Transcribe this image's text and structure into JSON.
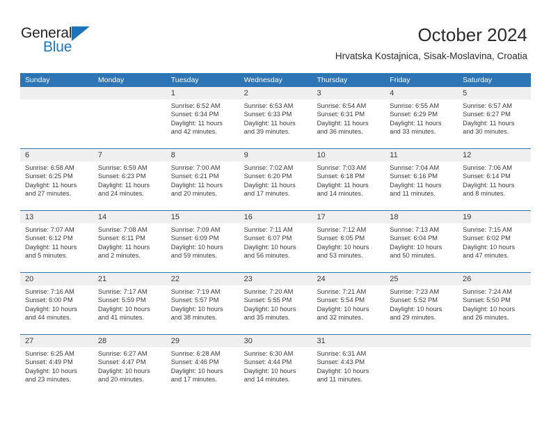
{
  "brand": {
    "name_top": "General",
    "name_bottom": "Blue",
    "accent_color": "#1b75bb"
  },
  "header": {
    "title": "October 2024",
    "subtitle": "Hrvatska Kostajnica, Sisak-Moslavina, Croatia"
  },
  "colors": {
    "header_blue": "#2e75b6",
    "daynum_gray": "#efefef",
    "text": "#3a3a3a"
  },
  "calendar": {
    "weekday_headers": [
      "Sunday",
      "Monday",
      "Tuesday",
      "Wednesday",
      "Thursday",
      "Friday",
      "Saturday"
    ],
    "weeks": [
      [
        {
          "day": "",
          "empty": true,
          "sunrise": "",
          "sunset": "",
          "daylight1": "",
          "daylight2": ""
        },
        {
          "day": "",
          "empty": true,
          "sunrise": "",
          "sunset": "",
          "daylight1": "",
          "daylight2": ""
        },
        {
          "day": "1",
          "sunrise": "Sunrise: 6:52 AM",
          "sunset": "Sunset: 6:34 PM",
          "daylight1": "Daylight: 11 hours",
          "daylight2": "and 42 minutes."
        },
        {
          "day": "2",
          "sunrise": "Sunrise: 6:53 AM",
          "sunset": "Sunset: 6:33 PM",
          "daylight1": "Daylight: 11 hours",
          "daylight2": "and 39 minutes."
        },
        {
          "day": "3",
          "sunrise": "Sunrise: 6:54 AM",
          "sunset": "Sunset: 6:31 PM",
          "daylight1": "Daylight: 11 hours",
          "daylight2": "and 36 minutes."
        },
        {
          "day": "4",
          "sunrise": "Sunrise: 6:55 AM",
          "sunset": "Sunset: 6:29 PM",
          "daylight1": "Daylight: 11 hours",
          "daylight2": "and 33 minutes."
        },
        {
          "day": "5",
          "sunrise": "Sunrise: 6:57 AM",
          "sunset": "Sunset: 6:27 PM",
          "daylight1": "Daylight: 11 hours",
          "daylight2": "and 30 minutes."
        }
      ],
      [
        {
          "day": "6",
          "sunrise": "Sunrise: 6:58 AM",
          "sunset": "Sunset: 6:25 PM",
          "daylight1": "Daylight: 11 hours",
          "daylight2": "and 27 minutes."
        },
        {
          "day": "7",
          "sunrise": "Sunrise: 6:59 AM",
          "sunset": "Sunset: 6:23 PM",
          "daylight1": "Daylight: 11 hours",
          "daylight2": "and 24 minutes."
        },
        {
          "day": "8",
          "sunrise": "Sunrise: 7:00 AM",
          "sunset": "Sunset: 6:21 PM",
          "daylight1": "Daylight: 11 hours",
          "daylight2": "and 20 minutes."
        },
        {
          "day": "9",
          "sunrise": "Sunrise: 7:02 AM",
          "sunset": "Sunset: 6:20 PM",
          "daylight1": "Daylight: 11 hours",
          "daylight2": "and 17 minutes."
        },
        {
          "day": "10",
          "sunrise": "Sunrise: 7:03 AM",
          "sunset": "Sunset: 6:18 PM",
          "daylight1": "Daylight: 11 hours",
          "daylight2": "and 14 minutes."
        },
        {
          "day": "11",
          "sunrise": "Sunrise: 7:04 AM",
          "sunset": "Sunset: 6:16 PM",
          "daylight1": "Daylight: 11 hours",
          "daylight2": "and 11 minutes."
        },
        {
          "day": "12",
          "sunrise": "Sunrise: 7:06 AM",
          "sunset": "Sunset: 6:14 PM",
          "daylight1": "Daylight: 11 hours",
          "daylight2": "and 8 minutes."
        }
      ],
      [
        {
          "day": "13",
          "sunrise": "Sunrise: 7:07 AM",
          "sunset": "Sunset: 6:12 PM",
          "daylight1": "Daylight: 11 hours",
          "daylight2": "and 5 minutes."
        },
        {
          "day": "14",
          "sunrise": "Sunrise: 7:08 AM",
          "sunset": "Sunset: 6:11 PM",
          "daylight1": "Daylight: 11 hours",
          "daylight2": "and 2 minutes."
        },
        {
          "day": "15",
          "sunrise": "Sunrise: 7:09 AM",
          "sunset": "Sunset: 6:09 PM",
          "daylight1": "Daylight: 10 hours",
          "daylight2": "and 59 minutes."
        },
        {
          "day": "16",
          "sunrise": "Sunrise: 7:11 AM",
          "sunset": "Sunset: 6:07 PM",
          "daylight1": "Daylight: 10 hours",
          "daylight2": "and 56 minutes."
        },
        {
          "day": "17",
          "sunrise": "Sunrise: 7:12 AM",
          "sunset": "Sunset: 6:05 PM",
          "daylight1": "Daylight: 10 hours",
          "daylight2": "and 53 minutes."
        },
        {
          "day": "18",
          "sunrise": "Sunrise: 7:13 AM",
          "sunset": "Sunset: 6:04 PM",
          "daylight1": "Daylight: 10 hours",
          "daylight2": "and 50 minutes."
        },
        {
          "day": "19",
          "sunrise": "Sunrise: 7:15 AM",
          "sunset": "Sunset: 6:02 PM",
          "daylight1": "Daylight: 10 hours",
          "daylight2": "and 47 minutes."
        }
      ],
      [
        {
          "day": "20",
          "sunrise": "Sunrise: 7:16 AM",
          "sunset": "Sunset: 6:00 PM",
          "daylight1": "Daylight: 10 hours",
          "daylight2": "and 44 minutes."
        },
        {
          "day": "21",
          "sunrise": "Sunrise: 7:17 AM",
          "sunset": "Sunset: 5:59 PM",
          "daylight1": "Daylight: 10 hours",
          "daylight2": "and 41 minutes."
        },
        {
          "day": "22",
          "sunrise": "Sunrise: 7:19 AM",
          "sunset": "Sunset: 5:57 PM",
          "daylight1": "Daylight: 10 hours",
          "daylight2": "and 38 minutes."
        },
        {
          "day": "23",
          "sunrise": "Sunrise: 7:20 AM",
          "sunset": "Sunset: 5:55 PM",
          "daylight1": "Daylight: 10 hours",
          "daylight2": "and 35 minutes."
        },
        {
          "day": "24",
          "sunrise": "Sunrise: 7:21 AM",
          "sunset": "Sunset: 5:54 PM",
          "daylight1": "Daylight: 10 hours",
          "daylight2": "and 32 minutes."
        },
        {
          "day": "25",
          "sunrise": "Sunrise: 7:23 AM",
          "sunset": "Sunset: 5:52 PM",
          "daylight1": "Daylight: 10 hours",
          "daylight2": "and 29 minutes."
        },
        {
          "day": "26",
          "sunrise": "Sunrise: 7:24 AM",
          "sunset": "Sunset: 5:50 PM",
          "daylight1": "Daylight: 10 hours",
          "daylight2": "and 26 minutes."
        }
      ],
      [
        {
          "day": "27",
          "sunrise": "Sunrise: 6:25 AM",
          "sunset": "Sunset: 4:49 PM",
          "daylight1": "Daylight: 10 hours",
          "daylight2": "and 23 minutes."
        },
        {
          "day": "28",
          "sunrise": "Sunrise: 6:27 AM",
          "sunset": "Sunset: 4:47 PM",
          "daylight1": "Daylight: 10 hours",
          "daylight2": "and 20 minutes."
        },
        {
          "day": "29",
          "sunrise": "Sunrise: 6:28 AM",
          "sunset": "Sunset: 4:46 PM",
          "daylight1": "Daylight: 10 hours",
          "daylight2": "and 17 minutes."
        },
        {
          "day": "30",
          "sunrise": "Sunrise: 6:30 AM",
          "sunset": "Sunset: 4:44 PM",
          "daylight1": "Daylight: 10 hours",
          "daylight2": "and 14 minutes."
        },
        {
          "day": "31",
          "sunrise": "Sunrise: 6:31 AM",
          "sunset": "Sunset: 4:43 PM",
          "daylight1": "Daylight: 10 hours",
          "daylight2": "and 11 minutes."
        },
        {
          "day": "",
          "empty": true,
          "sunrise": "",
          "sunset": "",
          "daylight1": "",
          "daylight2": ""
        },
        {
          "day": "",
          "empty": true,
          "sunrise": "",
          "sunset": "",
          "daylight1": "",
          "daylight2": ""
        }
      ]
    ]
  }
}
